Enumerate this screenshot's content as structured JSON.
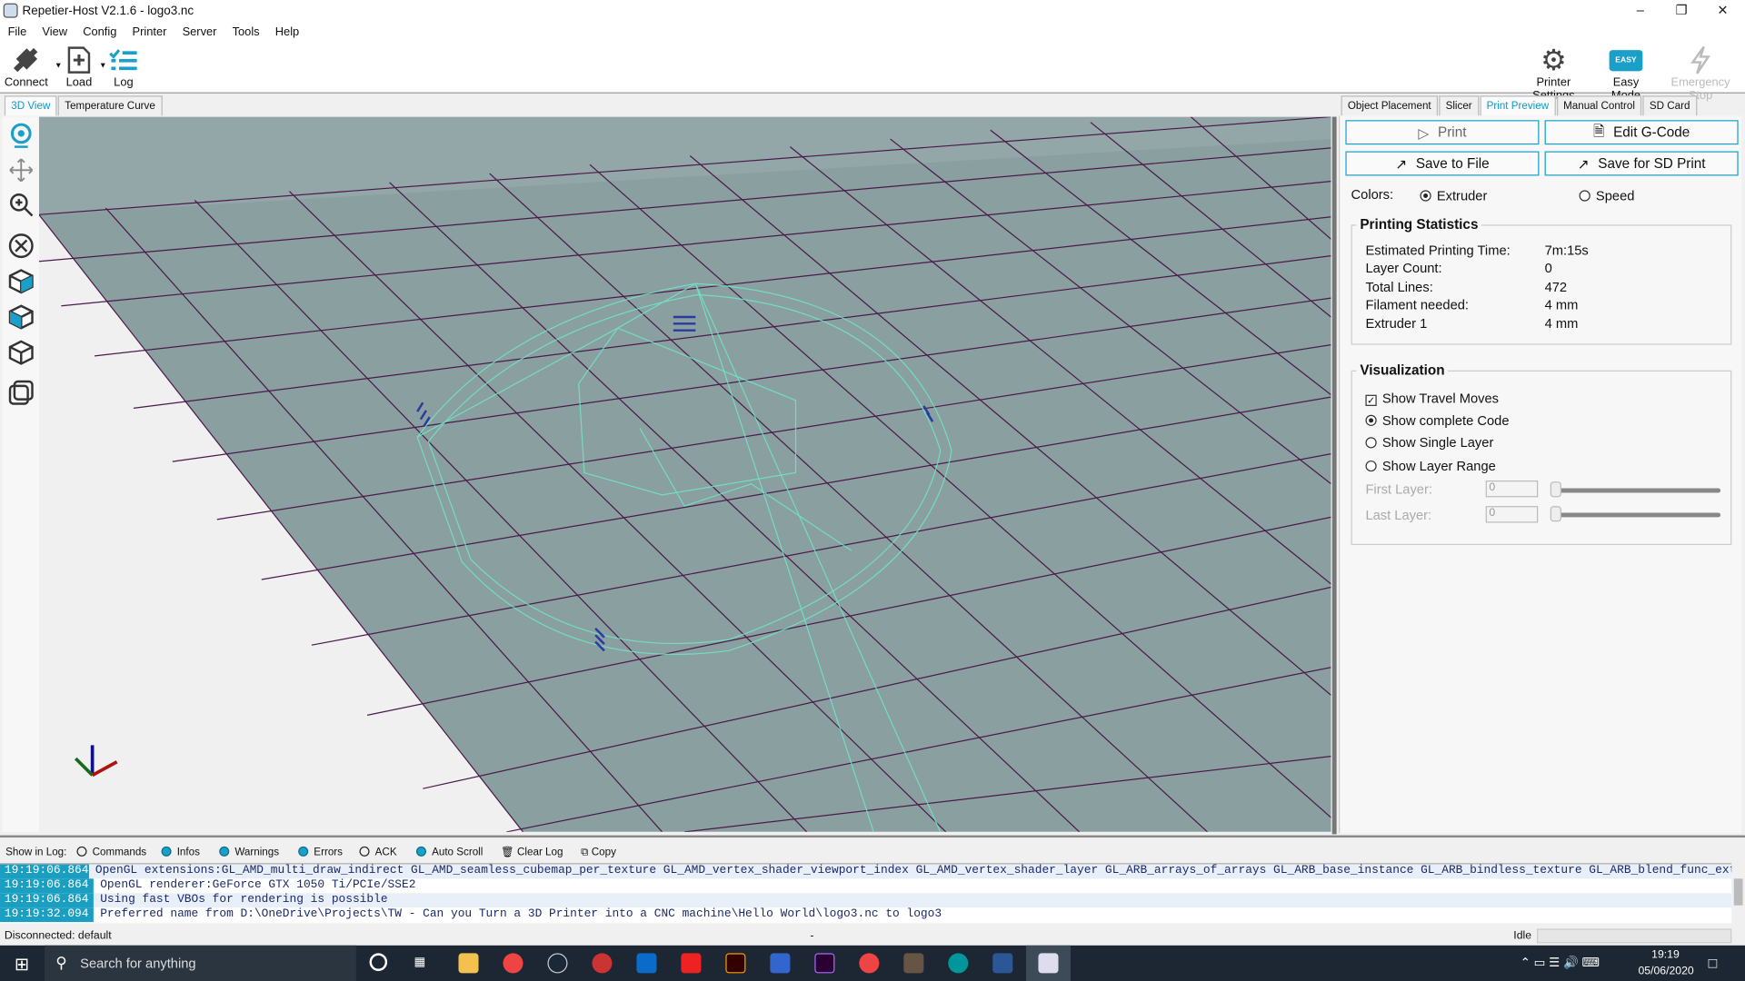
{
  "window": {
    "title": "Repetier-Host V2.1.6 - logo3.nc"
  },
  "menu": [
    "File",
    "View",
    "Config",
    "Printer",
    "Server",
    "Tools",
    "Help"
  ],
  "toolbar": {
    "connect": "Connect",
    "load": "Load",
    "log": "Log",
    "printer_settings": "Printer Settings",
    "easy_mode": "Easy Mode",
    "easy_badge": "EASY",
    "emergency_stop": "Emergency Stop"
  },
  "left_tabs": [
    "3D View",
    "Temperature Curve"
  ],
  "right_tabs": [
    "Object Placement",
    "Slicer",
    "Print Preview",
    "Manual Control",
    "SD Card"
  ],
  "actions": {
    "print": "Print",
    "edit_gcode": "Edit G-Code",
    "save_file": "Save to File",
    "save_sd": "Save for SD Print"
  },
  "colors_row": {
    "label": "Colors:",
    "extruder": "Extruder",
    "speed": "Speed",
    "selected": "Extruder"
  },
  "stats": {
    "title": "Printing Statistics",
    "rows": [
      {
        "label": "Estimated Printing Time:",
        "value": "7m:15s"
      },
      {
        "label": "Layer Count:",
        "value": "0"
      },
      {
        "label": "Total Lines:",
        "value": "472"
      },
      {
        "label": "Filament needed:",
        "value": "4 mm"
      },
      {
        "label": "Extruder 1",
        "value": "4 mm"
      }
    ]
  },
  "visualization": {
    "title": "Visualization",
    "travel": "Show Travel Moves",
    "travel_checked": true,
    "complete": "Show complete Code",
    "single": "Show Single Layer",
    "range": "Show Layer Range",
    "first_layer": "First Layer:",
    "first_value": "0",
    "last_layer": "Last Layer:",
    "last_value": "0"
  },
  "logbar": {
    "label": "Show in Log:",
    "commands": "Commands",
    "infos": "Infos",
    "warnings": "Warnings",
    "errors": "Errors",
    "ack": "ACK",
    "autoscroll": "Auto Scroll",
    "clear": "Clear Log",
    "copy": "Copy"
  },
  "log": [
    {
      "time": "19:19:06.864",
      "msg": "OpenGL extensions:GL_AMD_multi_draw_indirect GL_AMD_seamless_cubemap_per_texture GL_AMD_vertex_shader_viewport_index GL_AMD_vertex_shader_layer GL_ARB_arrays_of_arrays GL_ARB_base_instance GL_ARB_bindless_texture GL_ARB_blend_func_extended GL"
    },
    {
      "time": "19:19:06.864",
      "msg": "OpenGL renderer:GeForce GTX 1050 Ti/PCIe/SSE2"
    },
    {
      "time": "19:19:06.864",
      "msg": "Using fast VBOs for rendering is possible"
    },
    {
      "time": "19:19:32.094",
      "msg": "Preferred name from D:\\OneDrive\\Projects\\TW - Can you Turn a 3D Printer into a CNC machine\\Hello World\\logo3.nc to logo3"
    }
  ],
  "status": {
    "connection": "Disconnected: default",
    "dash": "-",
    "state": "Idle"
  },
  "taskbar": {
    "search": "Search for anything",
    "time": "19:19",
    "date": "05/06/2020"
  },
  "colors": {
    "accent": "#1aa0c8",
    "floor": "#8a9f9f",
    "grid": "#4a1a4a",
    "path": "#6ee8c8"
  }
}
